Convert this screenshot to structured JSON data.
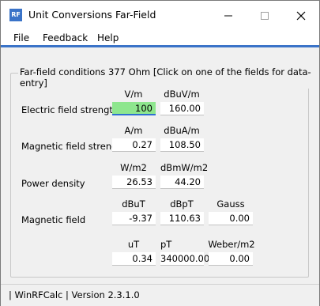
{
  "app": {
    "icon_text": "RF",
    "title": "Unit Conversions Far-Field"
  },
  "menu": [
    "File",
    "Feedback",
    "Help"
  ],
  "group": {
    "label": "Far-field conditions 377 Ohm [Click on one of the fields for data-entry]"
  },
  "rows": {
    "electric": {
      "label": "Electric field strength",
      "units": [
        "V/m",
        "dBuV/m"
      ],
      "values": [
        "100",
        "160.00"
      ]
    },
    "magnetic_strength": {
      "label": "Magnetic field strength",
      "units": [
        "A/m",
        "dBuA/m"
      ],
      "values": [
        "0.27",
        "108.50"
      ]
    },
    "power": {
      "label": "Power density",
      "units": [
        "W/m2",
        "dBmW/m2"
      ],
      "values": [
        "26.53",
        "44.20"
      ]
    },
    "magnetic_field": {
      "label": "Magnetic field",
      "units": [
        "dBuT",
        "dBpT",
        "Gauss"
      ],
      "values": [
        "-9.37",
        "110.63",
        "0.00"
      ]
    },
    "magnetic_field2": {
      "units": [
        "uT",
        "pT",
        "Weber/m2"
      ],
      "values": [
        "0.34",
        "340000.00",
        "0.00"
      ]
    }
  },
  "status": {
    "text": "| WinRFCalc | Version 2.3.1.0"
  },
  "colors": {
    "accent": "#3a73c8",
    "active_field": "#8ee68e"
  }
}
